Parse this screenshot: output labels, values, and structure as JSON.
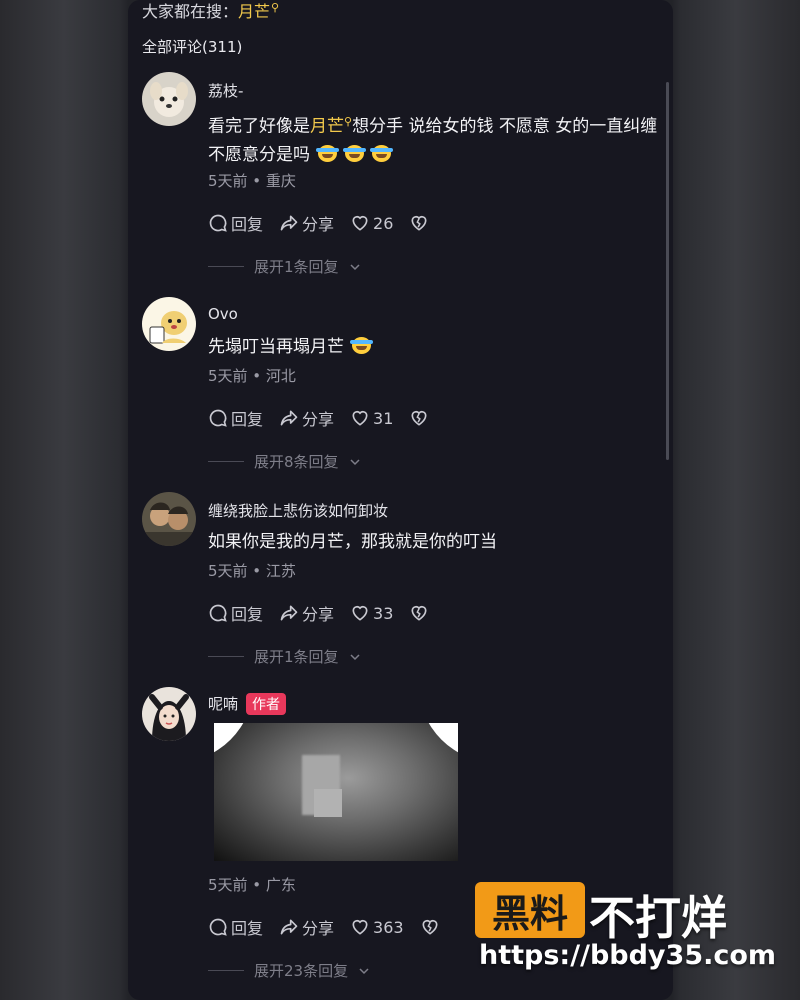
{
  "search": {
    "prefix": "大家都在搜：",
    "keyword": "月芒"
  },
  "comments_count": "全部评论(311)",
  "comments": [
    {
      "user": "荔枝-",
      "text_before": "看完了好像是",
      "highlight": "月芒",
      "text_after": "想分手 说给女的钱 不愿意 女的一直纠缠不愿意分是吗",
      "emoji_count": 3,
      "meta": "5天前 • 重庆",
      "reply_label": "回复",
      "share_label": "分享",
      "likes": "26",
      "expand_label": "展开1条回复"
    },
    {
      "user": "Ovo",
      "text": "先塌叮当再塌月芒",
      "meta": "5天前 • 河北",
      "reply_label": "回复",
      "share_label": "分享",
      "likes": "31",
      "expand_label": "展开8条回复"
    },
    {
      "user": "缠绕我脸上悲伤该如何卸妆",
      "text": "如果你是我的月芒，那我就是你的叮当",
      "meta": "5天前 • 江苏",
      "reply_label": "回复",
      "share_label": "分享",
      "likes": "33",
      "expand_label": "展开1条回复"
    },
    {
      "user": "呢喃",
      "author_tag": "作者",
      "meta": "5天前 • 广东",
      "reply_label": "回复",
      "share_label": "分享",
      "likes": "363",
      "expand_label": "展开23条回复"
    }
  ],
  "watermark": {
    "logo": "黑料",
    "name": "不打烊",
    "url": "https://bbdy35.com"
  },
  "colors": {
    "highlight": "#f2c94c",
    "author_tag": "#e8385b",
    "background": "#171720",
    "watermark_logo": "#f29a17"
  }
}
